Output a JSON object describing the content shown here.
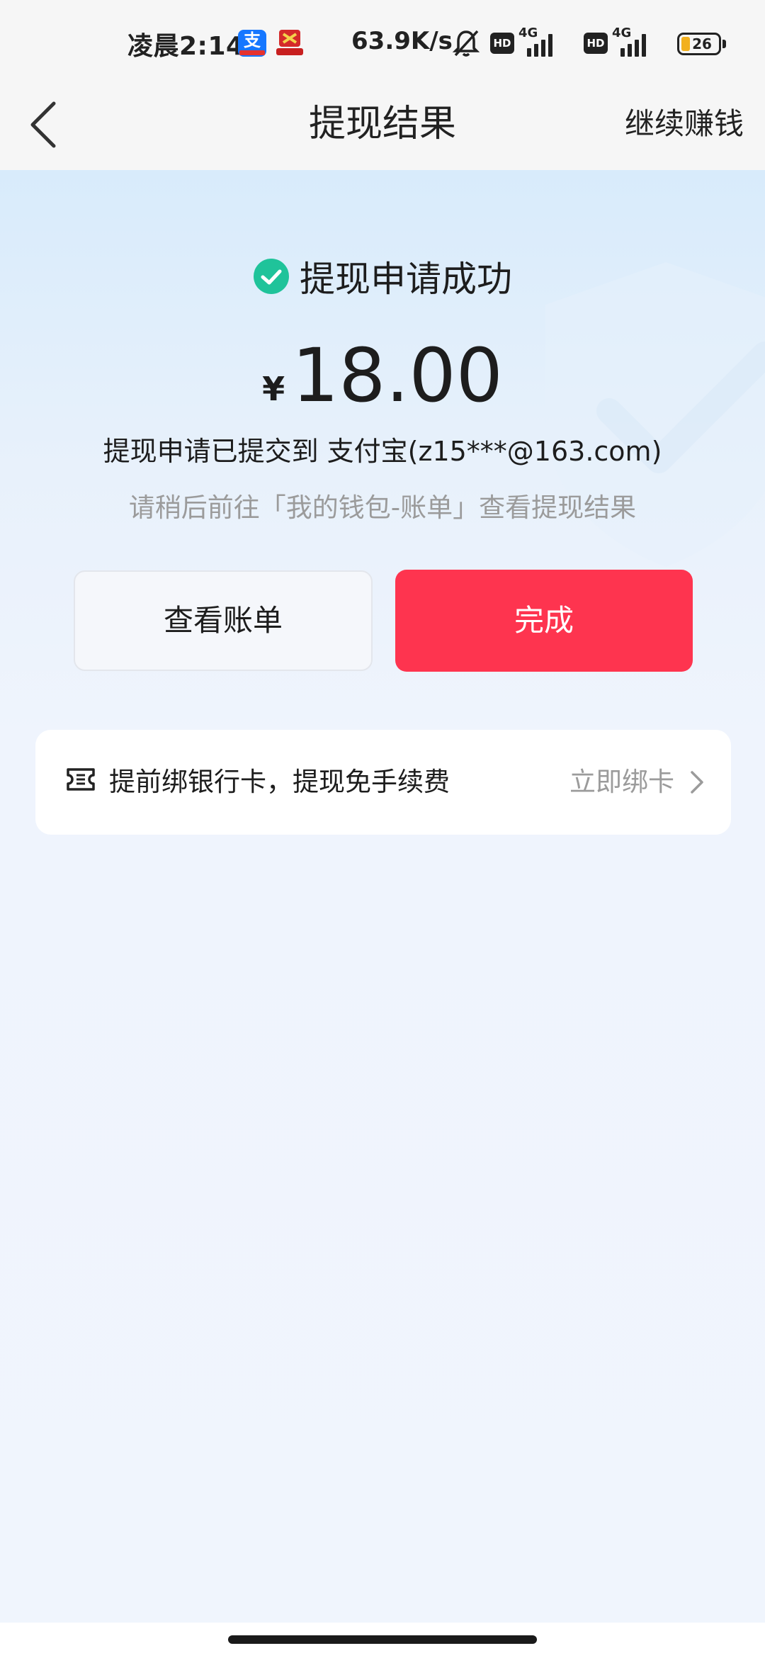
{
  "status_bar": {
    "time": "凌晨2:14",
    "net_speed": "63.9K/s",
    "hd1": "HD",
    "net1": "4G",
    "hd2": "HD",
    "net2": "4G",
    "battery": "26",
    "icons": [
      "alipay-app-icon",
      "game-app-icon",
      "bell-muted-icon",
      "signal-icon",
      "battery-icon"
    ]
  },
  "nav": {
    "title": "提现结果",
    "right_action": "继续赚钱"
  },
  "result": {
    "status_text": "提现申请成功",
    "currency": "¥",
    "amount": "18.00",
    "submitted_to": "提现申请已提交到 支付宝(z15***@163.com)",
    "hint": "请稍后前往「我的钱包-账单」查看提现结果"
  },
  "buttons": {
    "view_bill": "查看账单",
    "done": "完成"
  },
  "bind_card": {
    "text": "提前绑银行卡，提现免手续费",
    "action": "立即绑卡"
  },
  "colors": {
    "primary_red": "#fe344f",
    "success_green": "#1fc39a",
    "muted_text": "#9b9b9b"
  }
}
